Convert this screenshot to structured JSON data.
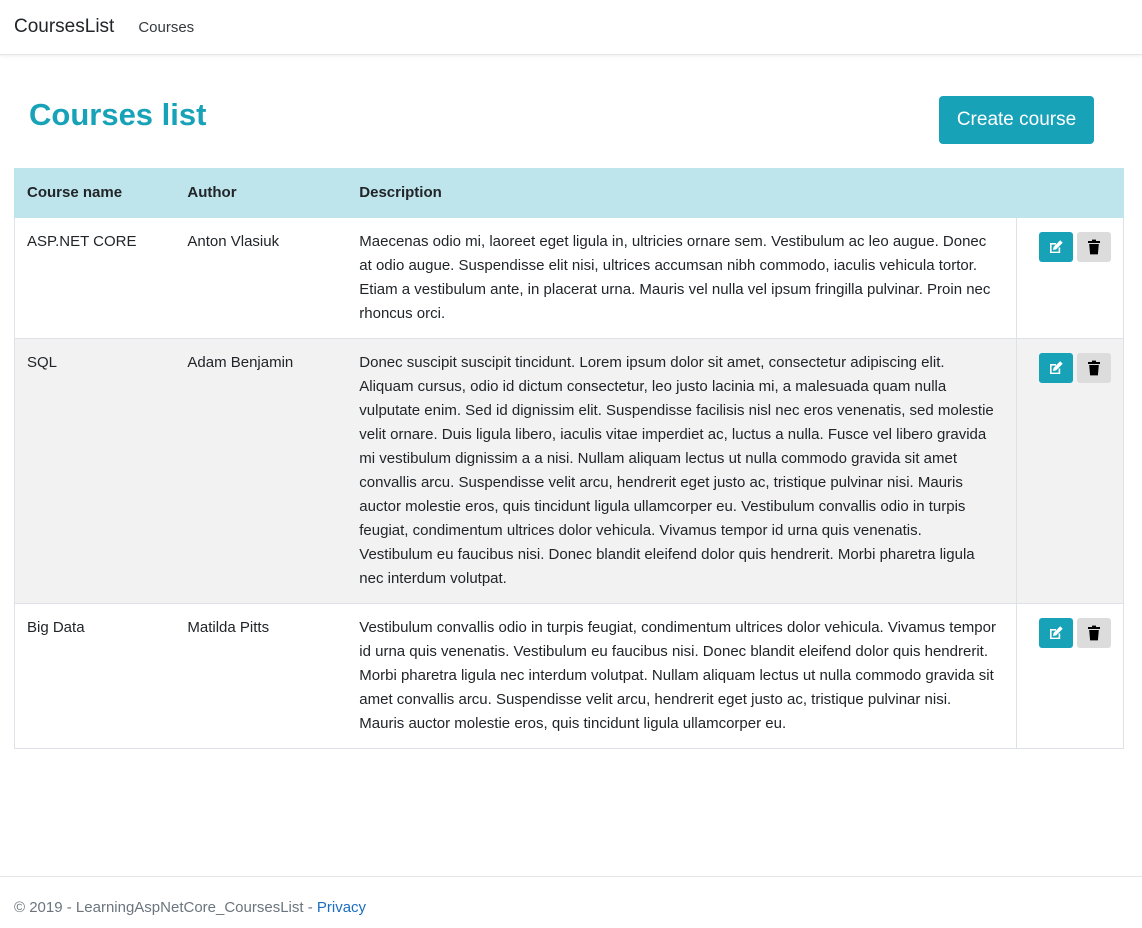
{
  "navbar": {
    "brand": "CoursesList",
    "links": [
      "Courses"
    ]
  },
  "page": {
    "title": "Courses list",
    "create_button": "Create course"
  },
  "table": {
    "headers": [
      "Course name",
      "Author",
      "Description"
    ],
    "rows": [
      {
        "name": "ASP.NET CORE",
        "author": "Anton Vlasiuk",
        "description": "Maecenas odio mi, laoreet eget ligula in, ultricies ornare sem. Vestibulum ac leo augue. Donec at odio augue. Suspendisse elit nisi, ultrices accumsan nibh commodo, iaculis vehicula tortor. Etiam a vestibulum ante, in placerat urna. Mauris vel nulla vel ipsum fringilla pulvinar. Proin nec rhoncus orci."
      },
      {
        "name": "SQL",
        "author": "Adam Benjamin",
        "description": "Donec suscipit suscipit tincidunt. Lorem ipsum dolor sit amet, consectetur adipiscing elit. Aliquam cursus, odio id dictum consectetur, leo justo lacinia mi, a malesuada quam nulla vulputate enim. Sed id dignissim elit. Suspendisse facilisis nisl nec eros venenatis, sed molestie velit ornare. Duis ligula libero, iaculis vitae imperdiet ac, luctus a nulla. Fusce vel libero gravida mi vestibulum dignissim a a nisi. Nullam aliquam lectus ut nulla commodo gravida sit amet convallis arcu. Suspendisse velit arcu, hendrerit eget justo ac, tristique pulvinar nisi. Mauris auctor molestie eros, quis tincidunt ligula ullamcorper eu. Vestibulum convallis odio in turpis feugiat, condimentum ultrices dolor vehicula. Vivamus tempor id urna quis venenatis. Vestibulum eu faucibus nisi. Donec blandit eleifend dolor quis hendrerit. Morbi pharetra ligula nec interdum volutpat."
      },
      {
        "name": "Big Data",
        "author": "Matilda Pitts",
        "description": "Vestibulum convallis odio in turpis feugiat, condimentum ultrices dolor vehicula. Vivamus tempor id urna quis venenatis. Vestibulum eu faucibus nisi. Donec blandit eleifend dolor quis hendrerit. Morbi pharetra ligula nec interdum volutpat. Nullam aliquam lectus ut nulla commodo gravida sit amet convallis arcu. Suspendisse velit arcu, hendrerit eget justo ac, tristique pulvinar nisi. Mauris auctor molestie eros, quis tincidunt ligula ullamcorper eu."
      }
    ],
    "row_icons": {
      "edit": "edit-icon",
      "delete": "trash-icon"
    }
  },
  "footer": {
    "copyright": "© 2019 - LearningAspNetCore_CoursesList - ",
    "privacy_link": "Privacy"
  },
  "colors": {
    "accent": "#17a2b8",
    "header_bg": "#bee5eb",
    "striped_row": "#f2f2f2",
    "delete_button": "#dcdcdc",
    "link": "#1b6ec2"
  }
}
